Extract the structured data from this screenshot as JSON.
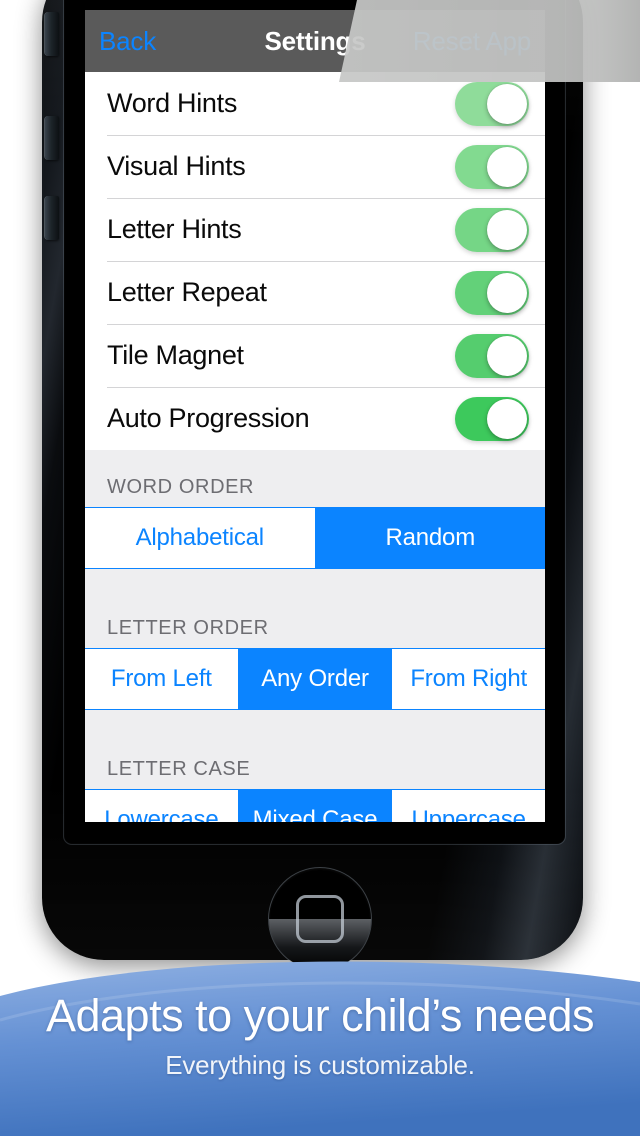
{
  "device": {
    "side_buttons": [
      {
        "name": "mute-switch"
      },
      {
        "name": "volume-up-button"
      },
      {
        "name": "volume-down-button"
      }
    ],
    "home_button_label": "Home"
  },
  "navbar": {
    "back_label": "Back",
    "title": "Settings",
    "reset_label": "Reset App",
    "title_color": "#ffffff",
    "tint_color": "#0b84ff",
    "background_left": "#5a5a5a",
    "background_right": "#b0b1b0"
  },
  "toggle_rows": [
    {
      "label": "Word Hints",
      "state": "on",
      "track_color": "#8fdc9a"
    },
    {
      "label": "Visual Hints",
      "state": "on",
      "track_color": "#82da90"
    },
    {
      "label": "Letter Hints",
      "state": "on",
      "track_color": "#75d686"
    },
    {
      "label": "Letter Repeat",
      "state": "on",
      "track_color": "#63d179"
    },
    {
      "label": "Tile Magnet",
      "state": "on",
      "track_color": "#55cd6e"
    },
    {
      "label": "Auto Progression",
      "state": "on",
      "track_color": "#3dc95c"
    }
  ],
  "sections": [
    {
      "header": "WORD ORDER",
      "options": [
        "Alphabetical",
        "Random"
      ],
      "selected_index": 1
    },
    {
      "header": "LETTER ORDER",
      "options": [
        "From Left",
        "Any Order",
        "From Right"
      ],
      "selected_index": 1
    },
    {
      "header": "LETTER CASE",
      "options": [
        "Lowercase",
        "Mixed Case",
        "Uppercase"
      ],
      "selected_index": 1
    }
  ],
  "banner": {
    "headline": "Adapts to your child’s needs",
    "subhead": "Everything is customizable.",
    "color_top": "#7ba3dd",
    "color_bottom": "#4a7fc8"
  }
}
